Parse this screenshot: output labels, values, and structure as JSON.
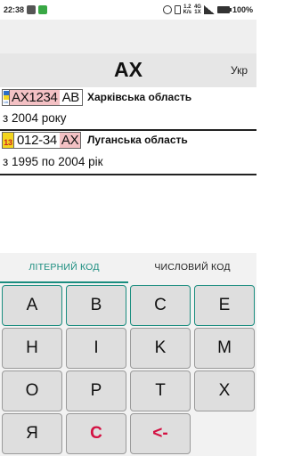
{
  "status_bar": {
    "time": "22:38",
    "network_lines": [
      "1.2",
      "K/s"
    ],
    "net_type_lines": [
      "4G",
      "1X"
    ],
    "battery": "100%"
  },
  "header": {
    "code": "AX",
    "language": "Укр"
  },
  "results": [
    {
      "plate_pink": "AX1234",
      "plate_plain": "AB",
      "flag_label": "UA",
      "region": "Харківська область",
      "years": "з 2004 року"
    },
    {
      "plate_region": "13",
      "plate_plain": "012-34",
      "plate_pink": "AX",
      "region": "Луганська область",
      "years": "з 1995 по 2004 рік"
    }
  ],
  "tabs": [
    {
      "label": "ЛІТЕРНИЙ КОД",
      "active": true
    },
    {
      "label": "ЧИСЛОВИЙ КОД",
      "active": false
    }
  ],
  "keys": [
    [
      "A",
      "B",
      "C",
      "E"
    ],
    [
      "H",
      "I",
      "K",
      "M"
    ],
    [
      "O",
      "P",
      "T",
      "X"
    ],
    [
      "Я",
      "C",
      "<-"
    ]
  ],
  "colors": {
    "accent": "#1a8d7f",
    "key_red": "#d31142",
    "plate_pink": "#f4c1c4",
    "header_bg": "#e6e6e6"
  }
}
